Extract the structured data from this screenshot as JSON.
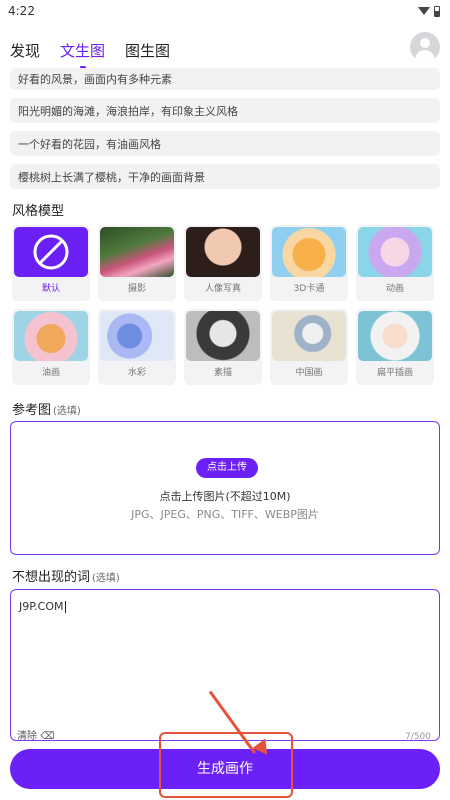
{
  "status_bar": {
    "time": "4:22"
  },
  "tabs": [
    {
      "label": "发现",
      "active": false
    },
    {
      "label": "文生图",
      "active": true
    },
    {
      "label": "图生图",
      "active": false
    }
  ],
  "prompts": [
    "好看的风景，画面内有多种元素",
    "阳光明媚的海滩，海浪拍岸，有印象主义风格",
    "一个好看的花园，有油画风格",
    "樱桃树上长满了樱桃，干净的画面背景"
  ],
  "styles_section": {
    "title": "风格模型",
    "items": [
      {
        "label": "默认",
        "selected": true
      },
      {
        "label": "摄影"
      },
      {
        "label": "人像写真"
      },
      {
        "label": "3D卡通"
      },
      {
        "label": "动画"
      },
      {
        "label": "油画"
      },
      {
        "label": "水彩"
      },
      {
        "label": "素描"
      },
      {
        "label": "中国画"
      },
      {
        "label": "扁平插画"
      }
    ]
  },
  "reference": {
    "title": "参考图",
    "optional": "(选填)",
    "upload_button": "点击上传",
    "main_text": "点击上传图片(不超过10M)",
    "formats": "JPG、JPEG、PNG、TIFF、WEBP图片"
  },
  "negative": {
    "title": "不想出现的词",
    "optional": "(选填)",
    "value": "J9P.COM",
    "clear_label": "清除",
    "counter": "7/500"
  },
  "generate_button": "生成画作",
  "colors": {
    "accent": "#6b21f5",
    "annotation": "#e5533d"
  }
}
